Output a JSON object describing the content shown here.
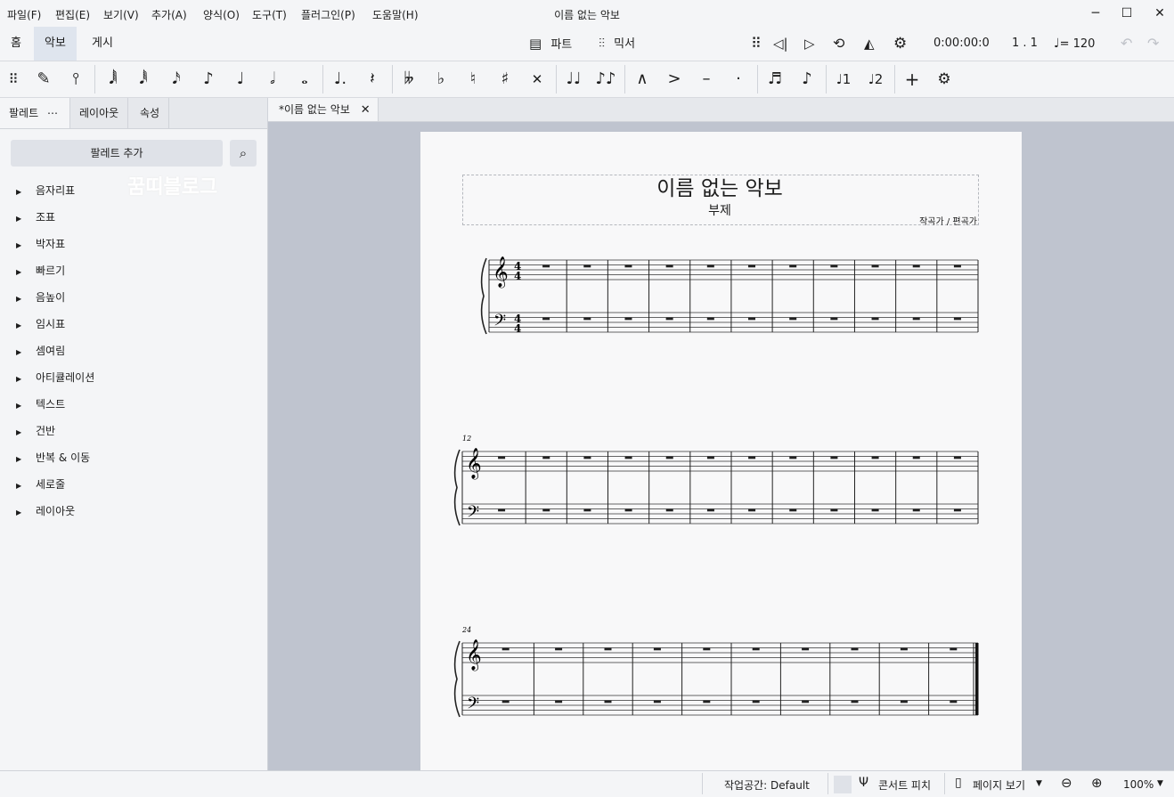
{
  "menu": [
    "파일(F)",
    "편집(E)",
    "보기(V)",
    "추가(A)",
    "양식(O)",
    "도구(T)",
    "플러그인(P)",
    "도움말(H)"
  ],
  "window_title": "이름 없는 악보",
  "mode_tabs": [
    "홈",
    "악보",
    "게시"
  ],
  "top_toolbar": {
    "parts_label": "파트",
    "mixer_label": "믹서",
    "time": "0:00:00:0",
    "position": "1 . 1",
    "tempo": "= 120"
  },
  "panel_tabs": [
    "팔레트",
    "레이아웃",
    "속성"
  ],
  "add_palette": "팔레트 추가",
  "watermark": "꿈띠블로그",
  "palettes": [
    "음자리표",
    "조표",
    "박자표",
    "빠르기",
    "음높이",
    "임시표",
    "셈여림",
    "아티큘레이션",
    "텍스트",
    "건반",
    "반복 & 이동",
    "세로줄",
    "레이아웃"
  ],
  "doc_tab": "*이름 없는 악보",
  "score": {
    "title": "이름 없는 악보",
    "subtitle": "부제",
    "composer": "작곡가 / 편곡가",
    "system_numbers": [
      "12",
      "24"
    ]
  },
  "status": {
    "workspace": "작업공간: Default",
    "concert_pitch": "콘서트 피치",
    "view_mode": "페이지 보기",
    "zoom": "100%"
  }
}
